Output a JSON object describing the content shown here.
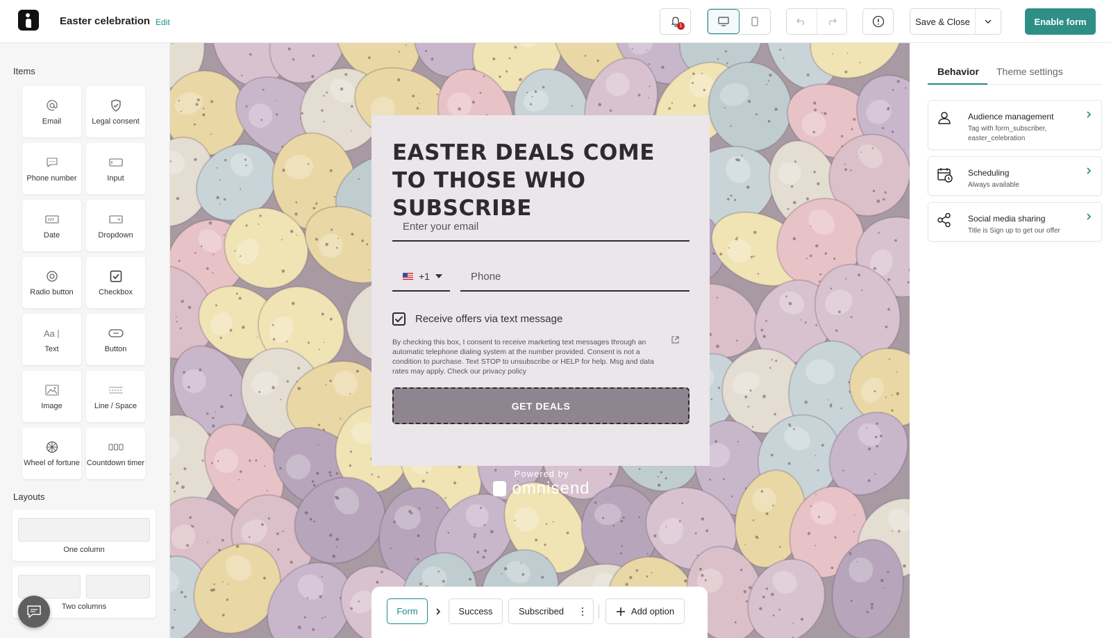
{
  "header": {
    "title": "Easter celebration",
    "edit_label": "Edit",
    "notification_count": "1",
    "save_close_label": "Save & Close",
    "enable_label": "Enable form"
  },
  "sidebar": {
    "items_heading": "Items",
    "items": [
      {
        "label": "Email",
        "icon": "at-icon"
      },
      {
        "label": "Legal consent",
        "icon": "shield-icon"
      },
      {
        "label": "Phone number",
        "icon": "chat-icon"
      },
      {
        "label": "Input",
        "icon": "input-icon"
      },
      {
        "label": "Date",
        "icon": "date-icon"
      },
      {
        "label": "Dropdown",
        "icon": "dropdown-icon"
      },
      {
        "label": "Radio button",
        "icon": "radio-icon"
      },
      {
        "label": "Checkbox",
        "icon": "checkbox-icon"
      },
      {
        "label": "Text",
        "icon": "text-icon"
      },
      {
        "label": "Button",
        "icon": "button-icon"
      },
      {
        "label": "Image",
        "icon": "image-icon"
      },
      {
        "label": "Line / Space",
        "icon": "line-icon"
      },
      {
        "label": "Wheel of fortune",
        "icon": "wheel-icon"
      },
      {
        "label": "Countdown timer",
        "icon": "timer-icon"
      }
    ],
    "layouts_heading": "Layouts",
    "layouts": [
      {
        "label": "One column"
      },
      {
        "label": "Two columns"
      }
    ]
  },
  "form": {
    "headline": "EASTER DEALS COME TO THOSE WHO SUBSCRIBE",
    "email_placeholder": "Enter your email",
    "country_code": "+1",
    "phone_placeholder": "Phone",
    "sms_label": "Receive offers via text message",
    "sms_checked": true,
    "consent_text": "By checking this box, I consent to receive marketing text messages through an automatic telephone dialing system at the number provided. Consent is not a condition to purchase. Text STOP to unsubscribe or HELP for help. Msg and data rates may apply. Check our privacy policy",
    "cta_label": "GET DEALS",
    "powered_by": "Powered by",
    "brand": "omnisend"
  },
  "steps": {
    "items": [
      "Form",
      "Success",
      "Subscribed"
    ],
    "active": "Form",
    "add_label": "Add option"
  },
  "right_panel": {
    "tabs": [
      "Behavior",
      "Theme settings"
    ],
    "active_tab": "Behavior",
    "settings": [
      {
        "title": "Audience management",
        "desc": "Tag with form_subscriber, easter_celebration"
      },
      {
        "title": "Scheduling",
        "desc": "Always available"
      },
      {
        "title": "Social media sharing",
        "desc": "Title is Sign up to get our offer"
      }
    ]
  },
  "colors": {
    "accent": "#2e8f87",
    "cta": "#8f8590",
    "popup_bg": "#ebe6ea",
    "badge": "#c62828"
  }
}
